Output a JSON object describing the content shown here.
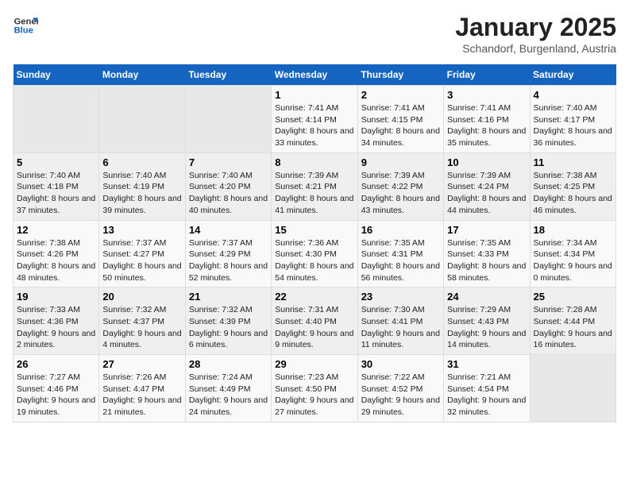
{
  "header": {
    "logo_general": "General",
    "logo_blue": "Blue",
    "month_title": "January 2025",
    "subtitle": "Schandorf, Burgenland, Austria"
  },
  "days_of_week": [
    "Sunday",
    "Monday",
    "Tuesday",
    "Wednesday",
    "Thursday",
    "Friday",
    "Saturday"
  ],
  "weeks": [
    [
      {
        "day": null,
        "content": null
      },
      {
        "day": null,
        "content": null
      },
      {
        "day": null,
        "content": null
      },
      {
        "day": "1",
        "content": "Sunrise: 7:41 AM\nSunset: 4:14 PM\nDaylight: 8 hours and 33 minutes."
      },
      {
        "day": "2",
        "content": "Sunrise: 7:41 AM\nSunset: 4:15 PM\nDaylight: 8 hours and 34 minutes."
      },
      {
        "day": "3",
        "content": "Sunrise: 7:41 AM\nSunset: 4:16 PM\nDaylight: 8 hours and 35 minutes."
      },
      {
        "day": "4",
        "content": "Sunrise: 7:40 AM\nSunset: 4:17 PM\nDaylight: 8 hours and 36 minutes."
      }
    ],
    [
      {
        "day": "5",
        "content": "Sunrise: 7:40 AM\nSunset: 4:18 PM\nDaylight: 8 hours and 37 minutes."
      },
      {
        "day": "6",
        "content": "Sunrise: 7:40 AM\nSunset: 4:19 PM\nDaylight: 8 hours and 39 minutes."
      },
      {
        "day": "7",
        "content": "Sunrise: 7:40 AM\nSunset: 4:20 PM\nDaylight: 8 hours and 40 minutes."
      },
      {
        "day": "8",
        "content": "Sunrise: 7:39 AM\nSunset: 4:21 PM\nDaylight: 8 hours and 41 minutes."
      },
      {
        "day": "9",
        "content": "Sunrise: 7:39 AM\nSunset: 4:22 PM\nDaylight: 8 hours and 43 minutes."
      },
      {
        "day": "10",
        "content": "Sunrise: 7:39 AM\nSunset: 4:24 PM\nDaylight: 8 hours and 44 minutes."
      },
      {
        "day": "11",
        "content": "Sunrise: 7:38 AM\nSunset: 4:25 PM\nDaylight: 8 hours and 46 minutes."
      }
    ],
    [
      {
        "day": "12",
        "content": "Sunrise: 7:38 AM\nSunset: 4:26 PM\nDaylight: 8 hours and 48 minutes."
      },
      {
        "day": "13",
        "content": "Sunrise: 7:37 AM\nSunset: 4:27 PM\nDaylight: 8 hours and 50 minutes."
      },
      {
        "day": "14",
        "content": "Sunrise: 7:37 AM\nSunset: 4:29 PM\nDaylight: 8 hours and 52 minutes."
      },
      {
        "day": "15",
        "content": "Sunrise: 7:36 AM\nSunset: 4:30 PM\nDaylight: 8 hours and 54 minutes."
      },
      {
        "day": "16",
        "content": "Sunrise: 7:35 AM\nSunset: 4:31 PM\nDaylight: 8 hours and 56 minutes."
      },
      {
        "day": "17",
        "content": "Sunrise: 7:35 AM\nSunset: 4:33 PM\nDaylight: 8 hours and 58 minutes."
      },
      {
        "day": "18",
        "content": "Sunrise: 7:34 AM\nSunset: 4:34 PM\nDaylight: 9 hours and 0 minutes."
      }
    ],
    [
      {
        "day": "19",
        "content": "Sunrise: 7:33 AM\nSunset: 4:36 PM\nDaylight: 9 hours and 2 minutes."
      },
      {
        "day": "20",
        "content": "Sunrise: 7:32 AM\nSunset: 4:37 PM\nDaylight: 9 hours and 4 minutes."
      },
      {
        "day": "21",
        "content": "Sunrise: 7:32 AM\nSunset: 4:39 PM\nDaylight: 9 hours and 6 minutes."
      },
      {
        "day": "22",
        "content": "Sunrise: 7:31 AM\nSunset: 4:40 PM\nDaylight: 9 hours and 9 minutes."
      },
      {
        "day": "23",
        "content": "Sunrise: 7:30 AM\nSunset: 4:41 PM\nDaylight: 9 hours and 11 minutes."
      },
      {
        "day": "24",
        "content": "Sunrise: 7:29 AM\nSunset: 4:43 PM\nDaylight: 9 hours and 14 minutes."
      },
      {
        "day": "25",
        "content": "Sunrise: 7:28 AM\nSunset: 4:44 PM\nDaylight: 9 hours and 16 minutes."
      }
    ],
    [
      {
        "day": "26",
        "content": "Sunrise: 7:27 AM\nSunset: 4:46 PM\nDaylight: 9 hours and 19 minutes."
      },
      {
        "day": "27",
        "content": "Sunrise: 7:26 AM\nSunset: 4:47 PM\nDaylight: 9 hours and 21 minutes."
      },
      {
        "day": "28",
        "content": "Sunrise: 7:24 AM\nSunset: 4:49 PM\nDaylight: 9 hours and 24 minutes."
      },
      {
        "day": "29",
        "content": "Sunrise: 7:23 AM\nSunset: 4:50 PM\nDaylight: 9 hours and 27 minutes."
      },
      {
        "day": "30",
        "content": "Sunrise: 7:22 AM\nSunset: 4:52 PM\nDaylight: 9 hours and 29 minutes."
      },
      {
        "day": "31",
        "content": "Sunrise: 7:21 AM\nSunset: 4:54 PM\nDaylight: 9 hours and 32 minutes."
      },
      {
        "day": null,
        "content": null
      }
    ]
  ]
}
